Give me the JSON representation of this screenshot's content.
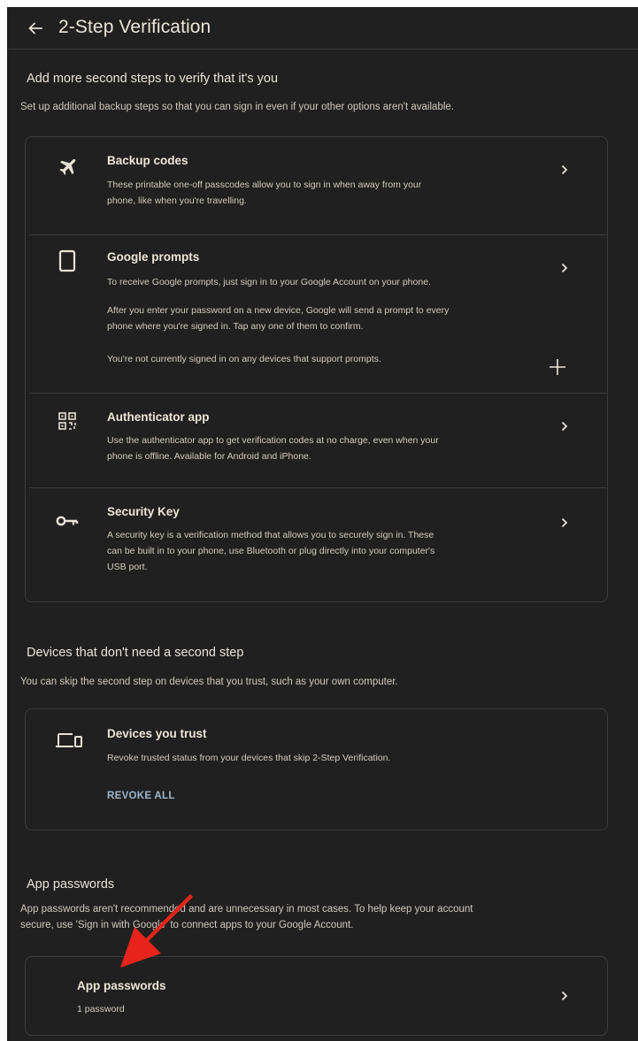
{
  "header": {
    "title": "2-Step Verification"
  },
  "section_second_steps": {
    "heading": "Add more second steps to verify that it's you",
    "description": "Set up additional backup steps so that you can sign in even if your other options aren't available.",
    "items": [
      {
        "title": "Backup codes",
        "lines": [
          "These printable one-off passcodes allow you to sign in when away from your",
          "phone, like when you're travelling."
        ],
        "icon": "airplane-icon"
      },
      {
        "title": "Google prompts",
        "lines": [
          "To receive Google prompts, just sign in to your Google Account on your phone."
        ],
        "extra_lines": [
          "After you enter your password on a new device, Google will send a prompt to every",
          "phone where you're signed in. Tap any one of them to confirm."
        ],
        "note": "You're not currently signed in on any devices that support prompts.",
        "icon": "phone-icon"
      },
      {
        "title": "Authenticator app",
        "lines": [
          "Use the authenticator app to get verification codes at no charge, even when your",
          "phone is offline. Available for Android and iPhone."
        ],
        "icon": "qr-code-icon"
      },
      {
        "title": "Security Key",
        "lines": [
          "A security key is a verification method that allows you to securely sign in. These",
          "can be built in to your phone, use Bluetooth or plug directly into your computer's",
          "USB port."
        ],
        "icon": "key-icon"
      }
    ]
  },
  "section_devices": {
    "heading": "Devices that don't need a second step",
    "description": "You can skip the second step on devices that you trust, such as your own computer.",
    "card": {
      "title": "Devices you trust",
      "text": "Revoke trusted status from your devices that skip 2-Step Verification.",
      "action_label": "REVOKE ALL",
      "icon": "devices-icon"
    }
  },
  "section_app_passwords": {
    "heading": "App passwords",
    "description_lines": [
      "App passwords aren't recommended and are unnecessary in most cases. To help keep your account",
      "secure, use 'Sign in with Google' to connect apps to your Google Account."
    ],
    "card": {
      "title": "App passwords",
      "subtitle": "1 password"
    }
  },
  "colors": {
    "background": "#202020",
    "text": "#ece6da",
    "border": "#3c3c3c",
    "link": "#9fb6c9",
    "annotation_arrow": "#e8241a"
  }
}
